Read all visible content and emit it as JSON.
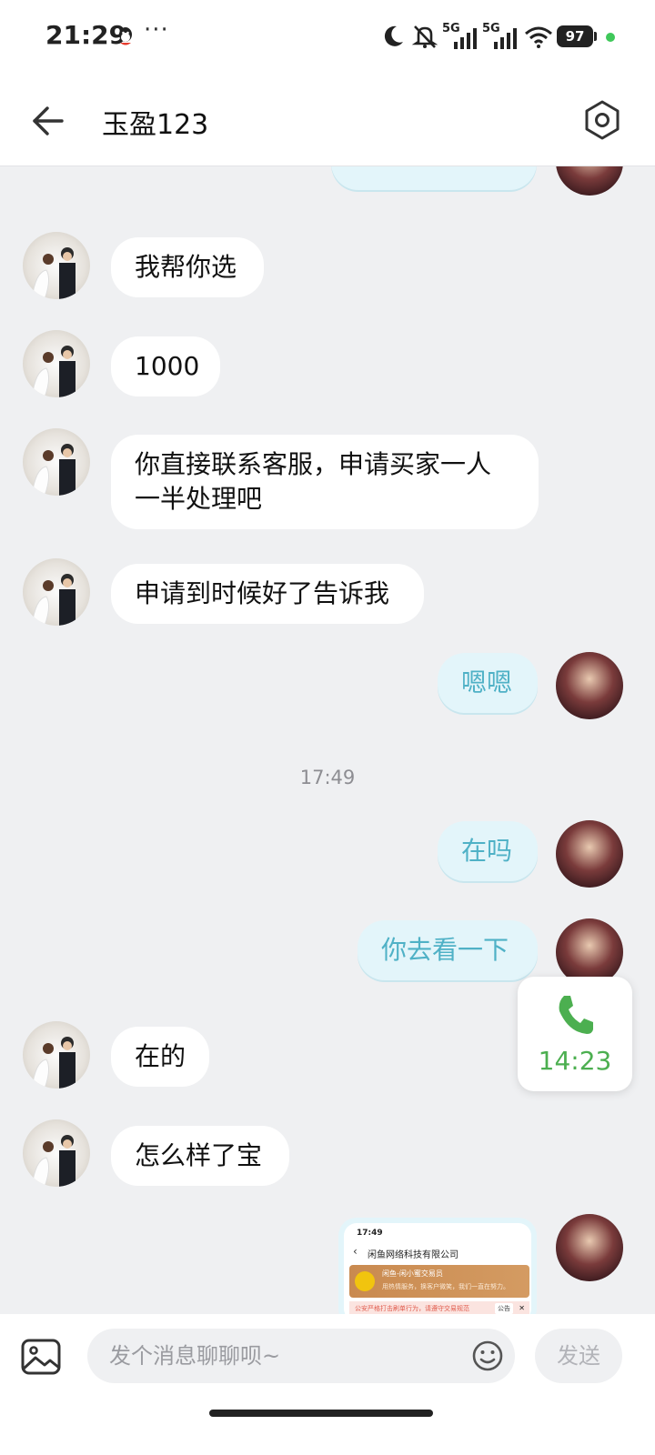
{
  "status_bar": {
    "time": "21:29",
    "network_1": "5G",
    "network_2": "5G",
    "battery": "97",
    "icons": [
      "qq-icon",
      "more-dots-icon",
      "moon-icon",
      "bell-muted-icon",
      "signal-icon",
      "wifi-icon",
      "battery-icon"
    ]
  },
  "header": {
    "title": "玉盈123",
    "back_icon": "arrow-left-icon",
    "settings_icon": "hexagon-settings-icon"
  },
  "messages": [
    {
      "side": "right",
      "text": "…"
    },
    {
      "side": "left",
      "text": "我帮你选"
    },
    {
      "side": "left",
      "text": "1000"
    },
    {
      "side": "left",
      "text": "你直接联系客服，申请买家一人一半处理吧"
    },
    {
      "side": "left",
      "text": "申请到时候好了告诉我"
    },
    {
      "side": "right",
      "text": "嗯嗯"
    },
    {
      "side": "right",
      "text": "在吗"
    },
    {
      "side": "right",
      "text": "你去看一下"
    },
    {
      "side": "left",
      "text": "在的"
    },
    {
      "side": "left",
      "text": "怎么样了宝"
    }
  ],
  "timestamp": "17:49",
  "call_card": {
    "duration": "14:23",
    "icon": "phone-icon",
    "accent": "#4caf50"
  },
  "screenshot_message": {
    "status_time": "17:49",
    "title": "闲鱼网络科技有限公司",
    "band_line1": "闲鱼-闲小蜜交易员",
    "band_line2": "用热情服务，换客户微笑，我们一直在努力。",
    "notice": "公安严格打击刷单行为，请遵守交易规范",
    "notice_tag": "公告"
  },
  "input_bar": {
    "placeholder": "发个消息聊聊呗~",
    "send_label": "发送",
    "image_icon": "image-icon",
    "emoji_icon": "emoji-icon"
  },
  "colors": {
    "chat_background": "#eff0f2",
    "outgoing_bubble": "#e3f5fa",
    "outgoing_text": "#4fb1c6",
    "incoming_bubble": "#ffffff"
  }
}
